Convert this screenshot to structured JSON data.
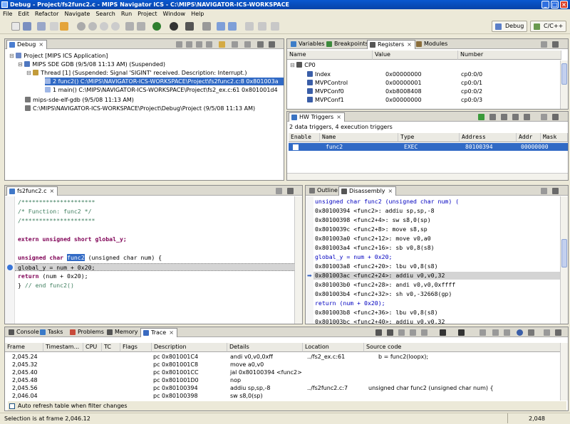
{
  "window": {
    "title": "Debug - Project/fs2func2.c - MIPS Navigator ICS - C:\\MIPS\\NAVIGATOR-ICS-WORKSPACE"
  },
  "menu": [
    "File",
    "Edit",
    "Refactor",
    "Navigate",
    "Search",
    "Run",
    "Project",
    "Window",
    "Help"
  ],
  "perspectives": {
    "debug": "Debug",
    "cpp": "C/C++"
  },
  "debug_view": {
    "tab": "Debug",
    "tree": [
      "Project [MIPS ICS Application]",
      "MIPS SDE GDB (9/5/08 11:13 AM) (Suspended)",
      "Thread [1] (Suspended: Signal 'SIGINT' received. Description: Interrupt.)",
      "2 func2() C:\\MIPS\\NAVIGATOR-ICS-WORKSPACE\\Project\\fs2func2.c:8 0x801003a",
      "1 main() C:\\MIPS\\NAVIGATOR-ICS-WORKSPACE\\Project\\fs2_ex.c:61 0x801001d4",
      "mips-sde-elf-gdb (9/5/08 11:13 AM)",
      "C:\\MIPS\\NAVIGATOR-ICS-WORKSPACE\\Project\\Debug\\Project (9/5/08 11:13 AM)"
    ]
  },
  "registers_view": {
    "tabs": [
      "Variables",
      "Breakpoints",
      "Registers",
      "Modules"
    ],
    "columns": [
      "Name",
      "Value",
      "Number"
    ],
    "group": "CP0",
    "rows": [
      {
        "name": "Index",
        "value": "0x00000000",
        "number": "cp0:0/0"
      },
      {
        "name": "MVPControl",
        "value": "0x00000001",
        "number": "cp0:0/1"
      },
      {
        "name": "MVPConf0",
        "value": "0xb8008408",
        "number": "cp0:0/2"
      },
      {
        "name": "MVPConf1",
        "value": "0x00000000",
        "number": "cp0:0/3"
      }
    ]
  },
  "hw_triggers": {
    "tab": "HW Triggers",
    "summary": "2 data triggers, 4 execution triggers",
    "columns": [
      "Enable",
      "Name",
      "Type",
      "Address",
      "Addr",
      "Mask"
    ],
    "rows": [
      {
        "name": "func2",
        "type": "EXEC",
        "address": "80100394",
        "mask": "00000000"
      }
    ]
  },
  "editor": {
    "tab": "fs2func2.c",
    "lines": [
      "/*********************",
      "/* Function:  func2 */",
      "/*********************",
      "",
      "extern unsigned short global_y;",
      "",
      "unsigned char func2 (unsigned char num)   {",
      "   global_y = num + 0x20;",
      "     return (num + 0x20);",
      "} // end func2()"
    ],
    "highlight_word": "func2"
  },
  "disassembly": {
    "tabs": [
      "Outline",
      "Disassembly"
    ],
    "lines": [
      "unsigned char func2 (unsigned char num)   (",
      "0x80100394 <func2>:    addiu sp,sp,-8",
      "0x80100398 <func2+4>:  sw    s8,0(sp)",
      "0x8010039c <func2+8>:  move  s8,sp",
      "0x801003a0 <func2+12>: move  v0,a0",
      "0x801003a4 <func2+16>: sb    v0,8(s8)",
      "   global_y = num + 0x20;",
      "0x801003a8 <func2+20>: lbu   v0,8(s8)",
      "0x801003ac <func2+24>: addiu v0,v0,32",
      "0x801003b0 <func2+28>: andi  v0,v0,0xffff",
      "0x801003b4 <func2+32>: sh    v0,-32668(gp)",
      "   return (num + 0x20);",
      "0x801003b8 <func2+36>: lbu   v0,8(s8)",
      "0x801003bc <func2+40>: addiu v0,v0,32"
    ],
    "current_index": 8
  },
  "trace_view": {
    "tabs": [
      "Console",
      "Tasks",
      "Problems",
      "Memory",
      "Trace"
    ],
    "columns": [
      "Frame",
      "Timestam...",
      "CPU",
      "TC",
      "Flags",
      "Description",
      "Details",
      "Location",
      "Source code"
    ],
    "rows": [
      {
        "frame": "2,045.24",
        "cpu": "",
        "desc": "pc  0x801001C4",
        "details": "andi v0,v0,0xff",
        "loc": "../fs2_ex.c:61",
        "src": "b = func2(loopx);"
      },
      {
        "frame": "2,045.32",
        "cpu": "",
        "desc": "pc  0x801001C8",
        "details": "move a0,v0",
        "loc": "",
        "src": ""
      },
      {
        "frame": "2,045.40",
        "cpu": "",
        "desc": "pc  0x801001CC",
        "details": "jal 0x80100394 <func2>",
        "loc": "",
        "src": ""
      },
      {
        "frame": "2,045.48",
        "cpu": "",
        "desc": "pc  0x801001D0",
        "details": "nop",
        "loc": "",
        "src": ""
      },
      {
        "frame": "2,045.56",
        "cpu": "",
        "desc": "pc  0x80100394",
        "details": "addiu sp,sp,-8",
        "loc": "../fs2func2.c:7",
        "src": "unsigned char func2 (unsigned char num)  {"
      },
      {
        "frame": "2,046.04",
        "cpu": "",
        "desc": "pc  0x80100398",
        "details": "sw s8,0(sp)",
        "loc": "",
        "src": ""
      }
    ],
    "auto_refresh_label": "Auto refresh table when filter changes"
  },
  "status": {
    "left": "Selection is at frame 2,046.12",
    "right": "2,048"
  },
  "colors": {
    "title_bar": "#0a58d0",
    "selection": "#316ac5",
    "keyword": "#7f0055",
    "comment": "#3f7f5f"
  }
}
